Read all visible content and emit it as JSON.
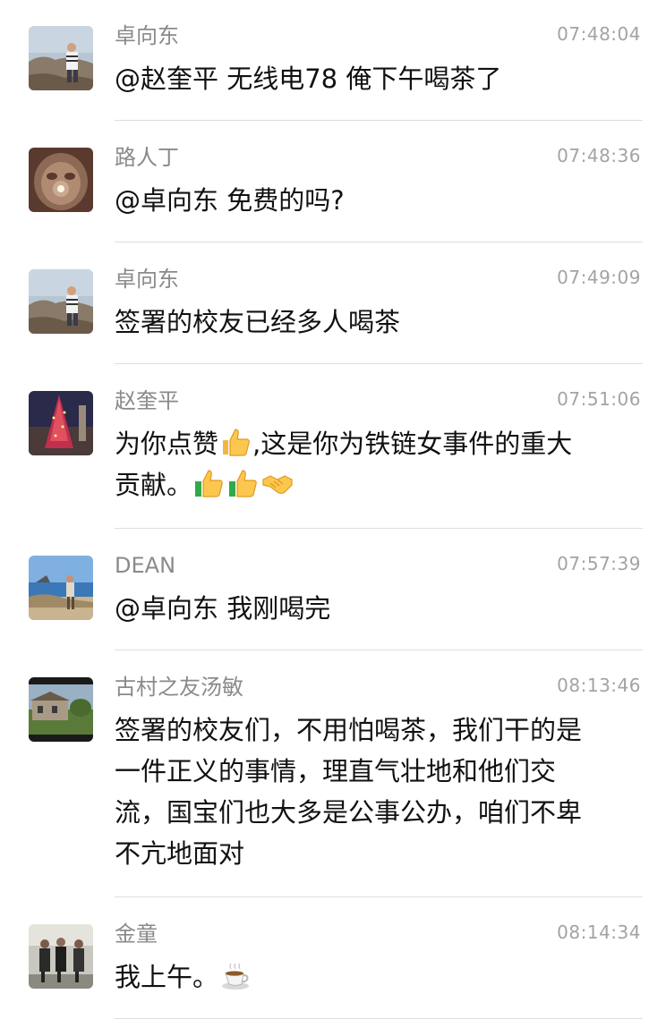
{
  "messages": [
    {
      "sender": "卓向东",
      "time": "07:48:04",
      "text": "@赵奎平 无线电78 俺下午喝茶了"
    },
    {
      "sender": "路人丁",
      "time": "07:48:36",
      "text": "@卓向东 免费的吗?"
    },
    {
      "sender": "卓向东",
      "time": "07:49:09",
      "text": "签署的校友已经多人喝茶"
    },
    {
      "sender": "赵奎平",
      "time": "07:51:06",
      "text_a": "为你点赞",
      "text_b": ",这是你为铁链女事件的重大",
      "text_c": "贡献。",
      "emojis": [
        "thumbs-up-emoji",
        "thumbs-up-emoji",
        "thumbs-up-emoji",
        "handshake-emoji"
      ]
    },
    {
      "sender": "DEAN",
      "time": "07:57:39",
      "text": "@卓向东 我刚喝完"
    },
    {
      "sender": "古村之友汤敏",
      "time": "08:13:46",
      "lines": [
        "签署的校友们，不用怕喝茶，我们干的是",
        "一件正义的事情，理直气壮地和他们交",
        "流，国宝们也大多是公事公办，咱们不卑",
        "不亢地面对"
      ]
    },
    {
      "sender": "金童",
      "time": "08:14:34",
      "text": "我上午。",
      "emojis": [
        "hot-tea-emoji"
      ]
    }
  ],
  "colors": {
    "sender": "#8a8a8a",
    "time": "#a3a3a3",
    "text": "#111111",
    "divider": "#dedede",
    "background": "#ffffff"
  }
}
